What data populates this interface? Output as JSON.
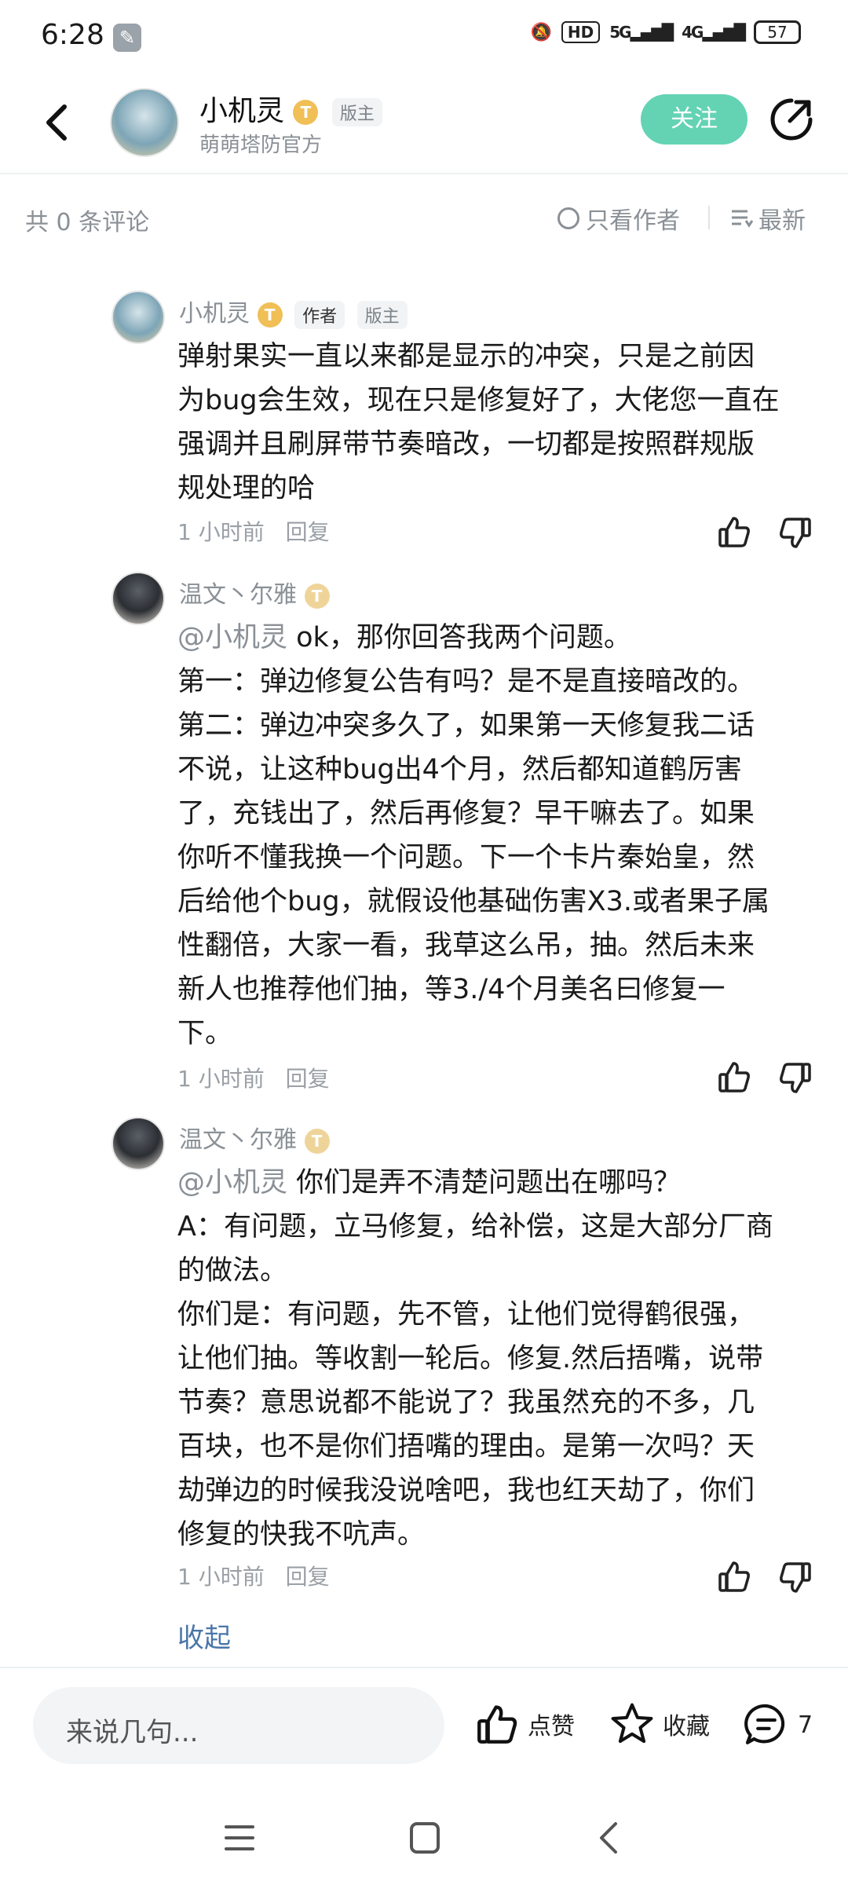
{
  "status_bar": {
    "time": "6:28",
    "hd_label": "HD",
    "net1": "5G",
    "net2": "4G",
    "battery": "57"
  },
  "header": {
    "name": "小机灵",
    "level_badge": "T",
    "role_badge": "版主",
    "subtitle": "萌萌塔防官方",
    "follow_label": "关注"
  },
  "sortbar": {
    "total": "共 0 条评论",
    "only_author": "只看作者",
    "sort": "最新"
  },
  "comments": [
    {
      "author": "小机灵",
      "level_badge": "T",
      "author_tag": "作者",
      "role_tag": "版主",
      "lines": [
        "弹射果实一直以来都是显示的冲突，只是之前因",
        "为bug会生效，现在只是修复好了，大佬您一直在",
        "强调并且刷屏带节奏暗改，一切都是按照群规版",
        "规处理的哈"
      ],
      "time": "1 小时前",
      "reply": "回复"
    },
    {
      "author": "温文丶尔雅",
      "level_badge": "T",
      "mention": "@小机灵",
      "lines": [
        " ok，那你回答我两个问题。",
        "第一：弹边修复公告有吗？是不是直接暗改的。",
        "第二：弹边冲突多久了，如果第一天修复我二话",
        "不说，让这种bug出4个月，然后都知道鹤厉害",
        "了，充钱出了，然后再修复？早干嘛去了。如果",
        "你听不懂我换一个问题。下一个卡片秦始皇，然",
        "后给他个bug，就假设他基础伤害X3.或者果子属",
        "性翻倍，大家一看，我草这么吊，抽。然后未来",
        "新人也推荐他们抽，等3./4个月美名曰修复一",
        "下。"
      ],
      "time": "1 小时前",
      "reply": "回复"
    },
    {
      "author": "温文丶尔雅",
      "level_badge": "T",
      "mention": "@小机灵",
      "lines": [
        " 你们是弄不清楚问题出在哪吗？",
        "A：有问题，立马修复，给补偿，这是大部分厂商",
        "的做法。",
        "你们是：有问题，先不管，让他们觉得鹤很强，",
        "让他们抽。等收割一轮后。修复.然后捂嘴，说带",
        "节奏？意思说都不能说了？我虽然充的不多，几",
        "百块，也不是你们捂嘴的理由。是第一次吗？天",
        "劫弹边的时候我没说啥吧，我也红天劫了，你们",
        "修复的快我不吭声。"
      ],
      "time": "1 小时前",
      "reply": "回复"
    }
  ],
  "collapse_label": "收起",
  "bottom": {
    "input_placeholder": "来说几句...",
    "like_label": "点赞",
    "favorite_label": "收藏",
    "comment_count": "7"
  }
}
